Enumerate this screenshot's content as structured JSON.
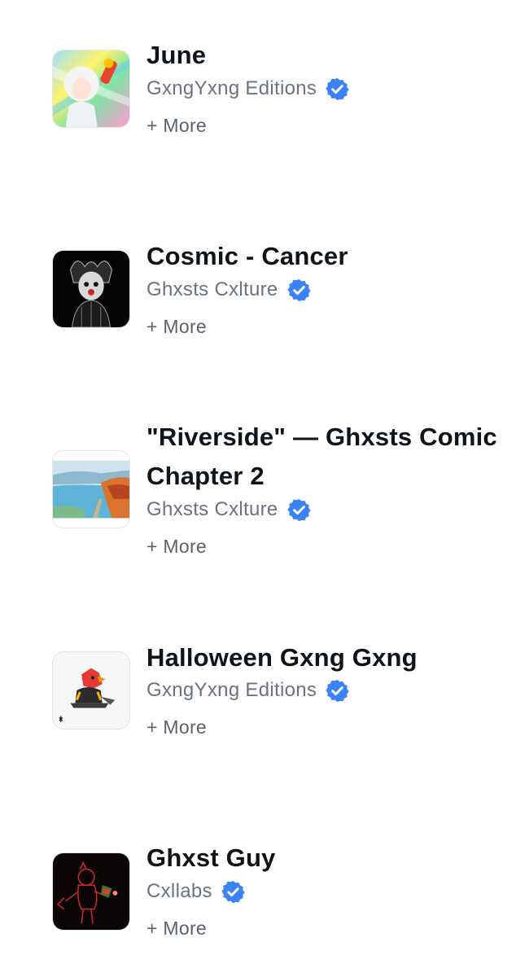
{
  "items": [
    {
      "title": "June",
      "creator": "GxngYxng Editions",
      "more_label": "+ More",
      "thumb_icon": "anime-character-artwork"
    },
    {
      "title": "Cosmic - Cancer",
      "creator": "Ghxsts Cxlture",
      "more_label": "+ More",
      "thumb_icon": "dark-character-artwork"
    },
    {
      "title_line1": "\"Riverside\" — Ghxsts Comic",
      "title_line2": "Chapter 2",
      "creator": "Ghxsts Cxlture",
      "more_label": "+ More",
      "thumb_icon": "river-landscape-artwork"
    },
    {
      "title": "Halloween Gxng Gxng",
      "creator": "GxngYxng Editions",
      "more_label": "+ More",
      "thumb_icon": "halloween-character-artwork"
    },
    {
      "title": "Ghxst Guy",
      "creator": "Cxllabs",
      "more_label": "+ More",
      "thumb_icon": "red-outline-character-artwork"
    }
  ],
  "colors": {
    "verified_badge": "#3b82f6",
    "title": "#0f1419",
    "creator": "#6b7280"
  }
}
